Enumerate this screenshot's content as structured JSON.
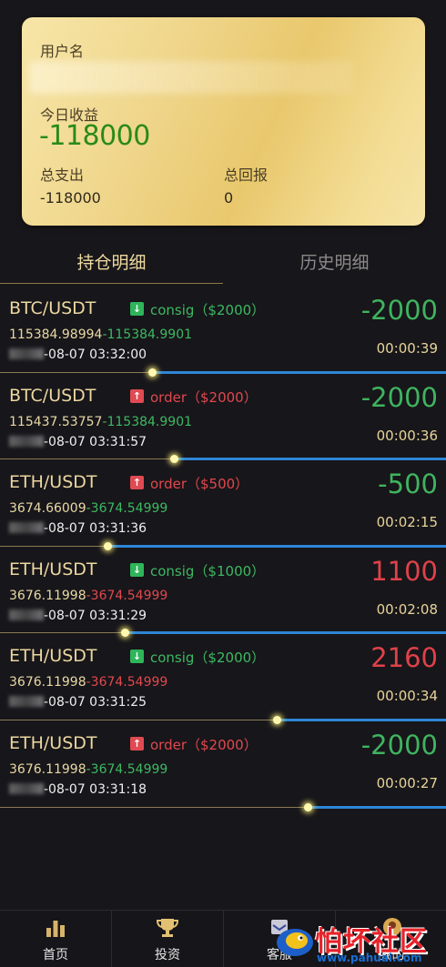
{
  "account": {
    "username_label": "用户名",
    "today_profit_label": "今日收益",
    "today_profit_value": "-118000",
    "total_expense_label": "总支出",
    "total_expense_value": "-118000",
    "total_return_label": "总回报",
    "total_return_value": "0"
  },
  "tabs": {
    "holdings": "持仓明细",
    "history": "历史明细"
  },
  "positions": [
    {
      "pair": "BTC/USDT",
      "direction": "down",
      "direction_text": "consig（$2000）",
      "open_price": "115384.98994",
      "current_price": "-115384.9901",
      "current_color": "green",
      "time": "-08-07 03:32:00",
      "pnl": "-2000",
      "pnl_color": "green",
      "countdown": "00:00:39",
      "progress": 0.34
    },
    {
      "pair": "BTC/USDT",
      "direction": "up",
      "direction_text": "order（$2000）",
      "open_price": "115437.53757",
      "current_price": "-115384.9901",
      "current_color": "green",
      "time": "-08-07 03:31:57",
      "pnl": "-2000",
      "pnl_color": "green",
      "countdown": "00:00:36",
      "progress": 0.39
    },
    {
      "pair": "ETH/USDT",
      "direction": "up",
      "direction_text": "order（$500）",
      "open_price": "3674.66009",
      "current_price": "-3674.54999",
      "current_color": "green",
      "time": "-08-07 03:31:36",
      "pnl": "-500",
      "pnl_color": "green",
      "countdown": "00:02:15",
      "progress": 0.24
    },
    {
      "pair": "ETH/USDT",
      "direction": "down",
      "direction_text": "consig（$1000）",
      "open_price": "3676.11998",
      "current_price": "-3674.54999",
      "current_color": "red",
      "time": "-08-07 03:31:29",
      "pnl": "1100",
      "pnl_color": "red",
      "countdown": "00:02:08",
      "progress": 0.28
    },
    {
      "pair": "ETH/USDT",
      "direction": "down",
      "direction_text": "consig（$2000）",
      "open_price": "3676.11998",
      "current_price": "-3674.54999",
      "current_color": "red",
      "time": "-08-07 03:31:25",
      "pnl": "2160",
      "pnl_color": "red",
      "countdown": "00:00:34",
      "progress": 0.62
    },
    {
      "pair": "ETH/USDT",
      "direction": "up",
      "direction_text": "order（$2000）",
      "open_price": "3676.11998",
      "current_price": "-3674.54999",
      "current_color": "green",
      "time": "-08-07 03:31:18",
      "pnl": "-2000",
      "pnl_color": "green",
      "countdown": "00:00:27",
      "progress": 0.69
    }
  ],
  "nav": {
    "home": "首页",
    "invest": "投资",
    "service": "客服",
    "mine": "我的"
  },
  "watermark": {
    "text": "怕坏社区",
    "url": "www.pahuai.com"
  },
  "colors": {
    "card_gold": "#efd58a",
    "profit_green": "#3fb45f",
    "loss_red": "#e0414a",
    "progress_blue": "#2e86d6"
  }
}
